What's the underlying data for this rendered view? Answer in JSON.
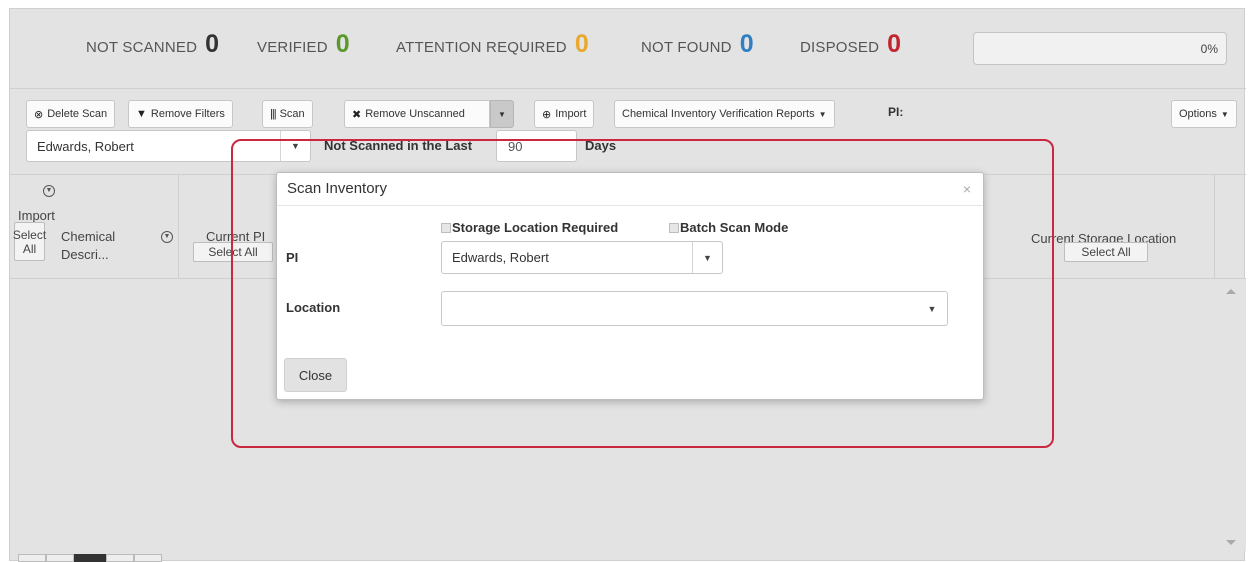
{
  "stats": {
    "not_scanned": {
      "label": "NOT SCANNED",
      "value": "0",
      "color": "#333333"
    },
    "verified": {
      "label": "VERIFIED",
      "value": "0",
      "color": "#5a9a2a"
    },
    "attention": {
      "label": "ATTENTION REQUIRED",
      "value": "0",
      "color": "#e8a92e"
    },
    "not_found": {
      "label": "NOT FOUND",
      "value": "0",
      "color": "#2f7fc2"
    },
    "disposed": {
      "label": "DISPOSED",
      "value": "0",
      "color": "#c0262d"
    }
  },
  "progress": {
    "value_pct": 0,
    "label": "0%"
  },
  "toolbar": {
    "delete_scan": "Delete Scan",
    "remove_filters": "Remove Filters",
    "scan": "Scan",
    "remove_unscanned": "Remove Unscanned",
    "import": "Import",
    "reports": "Chemical Inventory Verification Reports",
    "pi_label": "PI:",
    "options": "Options",
    "pi_value": "Edwards, Robert",
    "not_scanned_label": "Not Scanned in the Last",
    "days_value": "90",
    "days_label": "Days"
  },
  "table": {
    "col_import": "Import",
    "col_select": "Select",
    "col_all": "All",
    "col_chemical": "Chemical",
    "col_descr": "Descri...",
    "col_current_pi": "Current PI",
    "select_all": "Select All",
    "col_storage": "Current Storage Location",
    "storage_select_all": "Select All"
  },
  "modal": {
    "title": "Scan Inventory",
    "close_x": "×",
    "storage_required": "Storage Location Required",
    "batch_scan": "Batch Scan Mode",
    "pi_label": "PI",
    "pi_value": "Edwards, Robert",
    "location_label": "Location",
    "location_value": "",
    "close_button": "Close"
  },
  "icons": {
    "delete": "circle-x-icon",
    "filter": "filter-icon",
    "barcode": "barcode-icon",
    "remove": "x-icon",
    "import": "upload-circle-icon",
    "caret": "caret-down-icon"
  },
  "highlight_color": "#c9283e"
}
